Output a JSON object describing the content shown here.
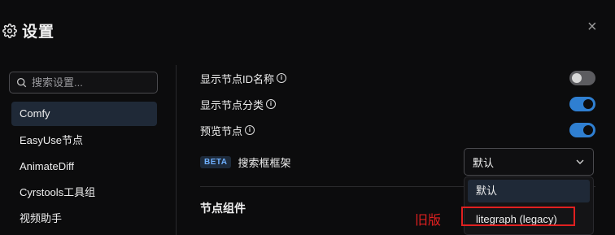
{
  "header": {
    "title": "设置",
    "close_icon": "close-icon"
  },
  "search": {
    "placeholder": "搜索设置..."
  },
  "sidebar": {
    "items": [
      {
        "label": "Comfy",
        "active": true
      },
      {
        "label": "EasyUse节点",
        "active": false
      },
      {
        "label": "AnimateDiff",
        "active": false
      },
      {
        "label": "Cyrstools工具组",
        "active": false
      },
      {
        "label": "视频助手",
        "active": false
      }
    ]
  },
  "settings": {
    "show_node_id": {
      "label": "显示节点ID名称",
      "enabled": false
    },
    "show_node_category": {
      "label": "显示节点分类",
      "enabled": true
    },
    "preview_node": {
      "label": "预览节点",
      "enabled": true
    },
    "search_framework": {
      "badge": "BETA",
      "label": "搜索框框架",
      "value": "默认",
      "options": [
        "默认",
        "litegraph (legacy)"
      ]
    }
  },
  "section": {
    "title": "节点组件"
  },
  "annotation": {
    "note": "旧版",
    "color": "#e02020"
  },
  "colors": {
    "accent": "#2f7fd1",
    "background": "#0c0c0d"
  }
}
